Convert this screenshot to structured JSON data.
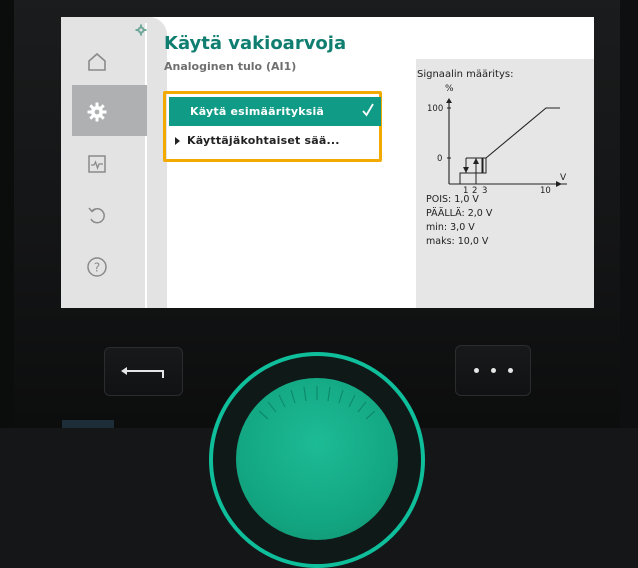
{
  "header": {
    "title": "Käytä vakioarvoja",
    "subtitle": "Analoginen tulo (AI1)"
  },
  "sidebar": {
    "items": [
      {
        "name": "home",
        "icon": "home-icon",
        "active": false
      },
      {
        "name": "settings",
        "icon": "gear-icon",
        "active": true
      },
      {
        "name": "diagnostics",
        "icon": "pulse-icon",
        "active": false
      },
      {
        "name": "restore",
        "icon": "undo-icon",
        "active": false
      },
      {
        "name": "help",
        "icon": "help-icon",
        "active": false
      }
    ]
  },
  "menu": {
    "items": [
      {
        "label": "Käytä esimäärityksiä",
        "selected": true,
        "checked": true
      },
      {
        "label": "Käyttäjäkohtaiset sää...",
        "selected": false,
        "submenu": true
      }
    ]
  },
  "signal_panel": {
    "title": "Signaalin määritys:",
    "y_unit": "%",
    "x_unit": "V",
    "y_ticks": [
      "100",
      "0"
    ],
    "x_ticks": [
      "1",
      "2",
      "3",
      "10"
    ],
    "params": [
      "POIS: 1,0 V",
      "PÄÄLLÄ: 2,0 V",
      "min: 3,0 V",
      "maks: 10,0 V"
    ]
  },
  "controls": {
    "back_icon": "back-arrow-icon",
    "more_icon": "more-dots-icon",
    "dial_icon": "rotary-knob"
  },
  "colors": {
    "accent": "#109b86",
    "title": "#0f7e70",
    "focus_frame": "#f2a900",
    "dial": "#13a783"
  }
}
